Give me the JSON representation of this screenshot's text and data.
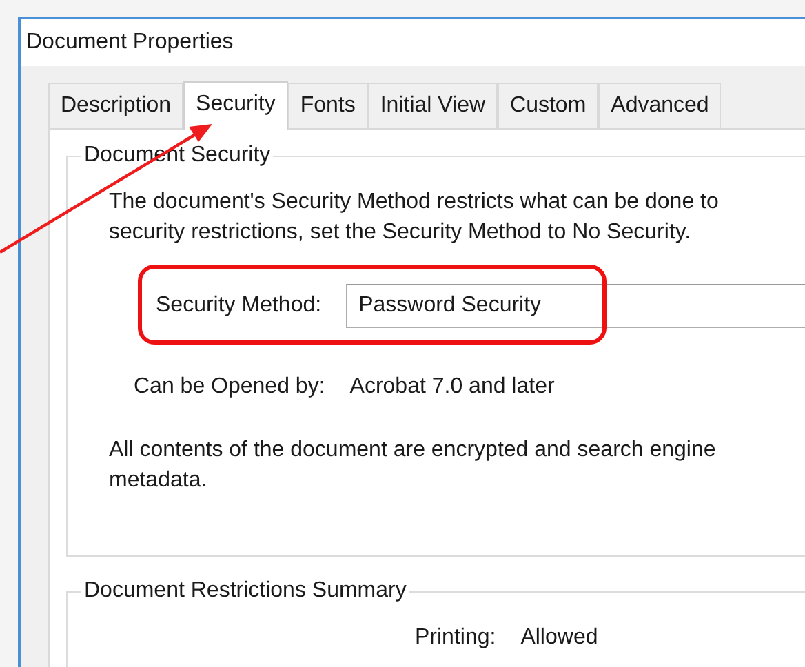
{
  "window": {
    "title": "Document Properties"
  },
  "tabs": [
    {
      "label": "Description",
      "selected": false
    },
    {
      "label": "Security",
      "selected": true
    },
    {
      "label": "Fonts",
      "selected": false
    },
    {
      "label": "Initial View",
      "selected": false
    },
    {
      "label": "Custom",
      "selected": false
    },
    {
      "label": "Advanced",
      "selected": false
    }
  ],
  "document_security": {
    "legend": "Document Security",
    "description_lines": [
      "The document's Security Method restricts what can be done to",
      "security restrictions, set the Security Method to No Security."
    ],
    "method_label": "Security Method:",
    "method_value": "Password Security",
    "opened_by_label": "Can be Opened by:",
    "opened_by_value": "Acrobat 7.0 and later",
    "encryption_note_lines": [
      "All contents of the document are encrypted and search engine",
      "metadata."
    ]
  },
  "restrictions_summary": {
    "legend": "Document Restrictions Summary",
    "rows": [
      {
        "label": "Printing:",
        "value": "Allowed"
      }
    ]
  }
}
